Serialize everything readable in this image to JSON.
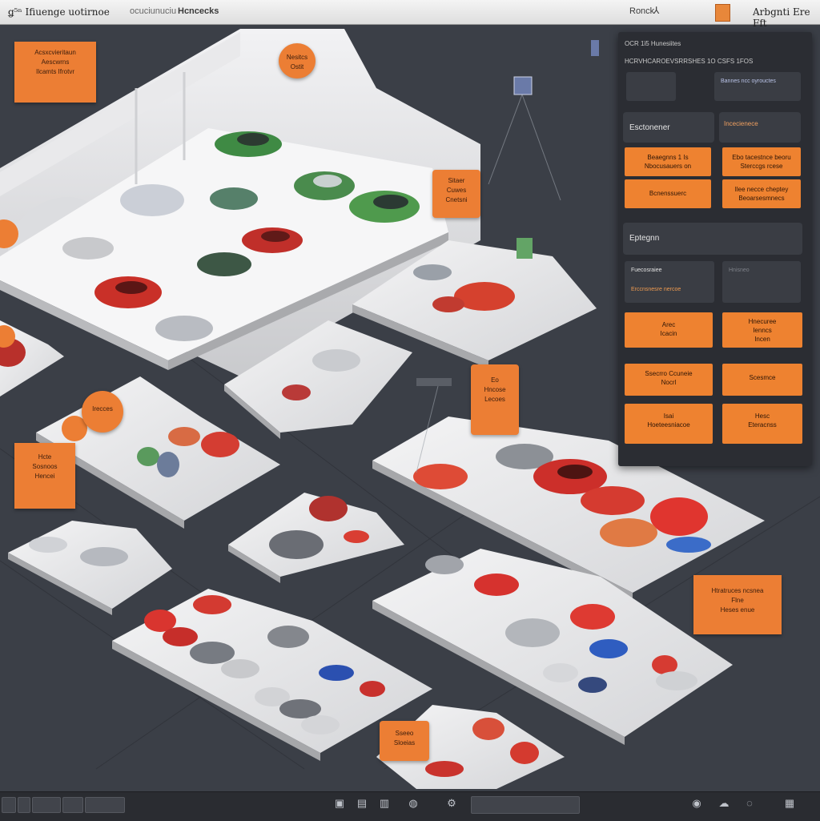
{
  "header": {
    "brand": "ǥ⁵ⁿ Ifiuenge uotirnoe",
    "menu_1": "ocuciunuciu",
    "menu_2": "Hcncecks",
    "search_text": "Ronck",
    "search_icon": "search-icon",
    "app_name": "Arbgnti Ere Fft"
  },
  "callouts": {
    "top_left": [
      "Acsxcvieritaun",
      "Aescwrns",
      "Ilcamts Ifrotvr"
    ],
    "top_circle": [
      "Nesitcs",
      "Ostit"
    ],
    "mid": [
      "Sitaer",
      "Cuwes",
      "Cnetsni"
    ],
    "center": [
      "Eo",
      "Hncose",
      "Lecoes"
    ],
    "left_circle": [
      "Irecces"
    ],
    "left_box": [
      "Hcte",
      "Sosnoos",
      "Hencei"
    ],
    "bottom_right": [
      "Htratruces ncsnea",
      "Flne",
      "Heses enue"
    ],
    "bottom": [
      "Sseeo",
      "Sloeias"
    ]
  },
  "panel": {
    "title_1": "OCR 1ϊ5 Hunesiites",
    "title_2": "HCRVHCAROEVSRRSHES 1O CSFS 1FOS",
    "field_1": "",
    "field_2": "Bannes ncc oyrouctes",
    "section_1_title": "Esctonener",
    "section_1_right": "Incecienece",
    "btn_1": [
      "Beaegnns 1 Is",
      "Nbocusauers on"
    ],
    "btn_2": [
      "Ebo tacestnce beoru",
      "Sterccgs rcese"
    ],
    "btn_3": [
      "Bcnenssuerc"
    ],
    "btn_4": [
      "Ilee necce cheptey",
      "Beoarsesmnecs"
    ],
    "section_2_title": "Eptegnn",
    "sub_1_a": "Fuecosraiee",
    "sub_1_b": "Erccnsnesre nercoe",
    "sub_2": "Hnisneo",
    "btn_5": [
      "Arec",
      "Icacin"
    ],
    "btn_6": [
      "Hnecuree",
      "Ienncs",
      "Incen"
    ],
    "btn_7": [
      "Ssecrro Ccuneie",
      "Nocrl"
    ],
    "btn_8": [
      "Scesmce"
    ],
    "btn_9": [
      "Isai",
      "Hoeteesniacoe"
    ],
    "btn_10": [
      "Hesc",
      "Eteracnss"
    ]
  },
  "taskbar": {
    "center_field": "",
    "icons": [
      "window-icon",
      "folder-icon",
      "chart-icon",
      "globe-icon",
      "settings-icon"
    ],
    "tray": [
      "user-icon",
      "cloud-icon",
      "network-icon",
      "calendar-icon"
    ]
  },
  "colors": {
    "accent": "#ec7e34",
    "panel_bg": "#2b2d33",
    "scene_bg": "#3b3f47",
    "platform": "#e4e4e6"
  }
}
